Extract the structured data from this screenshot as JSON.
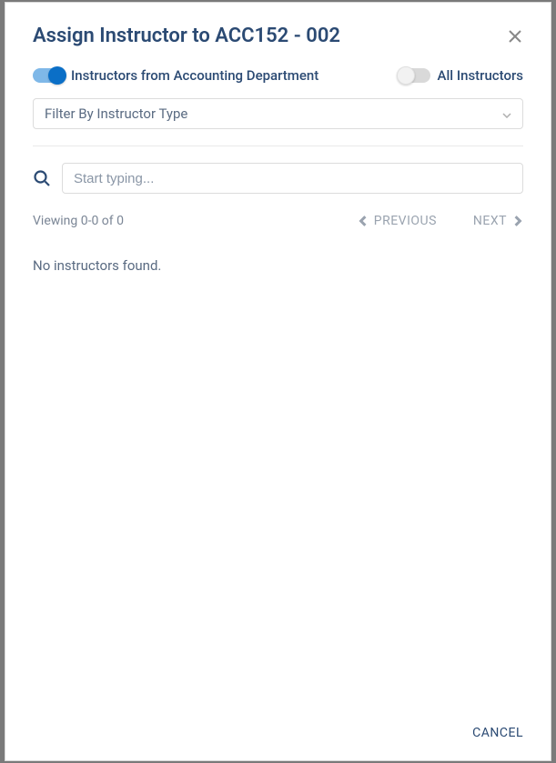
{
  "modal": {
    "title": "Assign Instructor to ACC152 - 002"
  },
  "toggles": {
    "department_label": "Instructors from Accounting Department",
    "all_label": "All Instructors"
  },
  "filter": {
    "placeholder": "Filter By Instructor Type"
  },
  "search": {
    "placeholder": "Start typing..."
  },
  "pager": {
    "viewing": "Viewing 0-0 of 0",
    "previous": "PREVIOUS",
    "next": "NEXT"
  },
  "results": {
    "empty": "No instructors found."
  },
  "footer": {
    "cancel": "CANCEL"
  }
}
